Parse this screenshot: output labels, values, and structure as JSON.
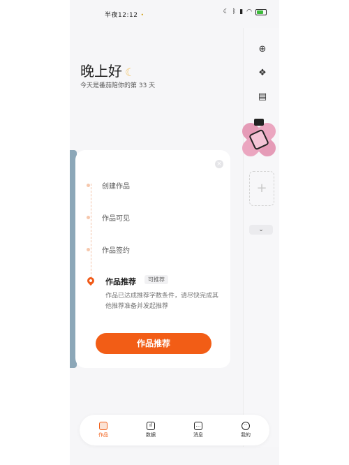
{
  "status": {
    "time": "半夜12:12",
    "indicator": "•"
  },
  "greeting": {
    "title": "晚上好",
    "moon": "☾",
    "days_text": "今天是番茄陪你的第 33 天"
  },
  "sidebar": {
    "add_icon": "plus-circle-icon",
    "grid_icon": "grid-icon",
    "calendar_icon": "calendar-icon",
    "plus": "+",
    "chevron": "⌄"
  },
  "card": {
    "close": "×",
    "steps": [
      "创建作品",
      "作品可见",
      "作品签约"
    ],
    "active": {
      "title": "作品推荐",
      "badge": "可推荐",
      "description": "作品已达成推荐字数条件，请尽快完成其他推荐准备并发起推荐"
    },
    "cta": "作品推荐"
  },
  "tabs": [
    {
      "label": "作品",
      "icon": "works-icon"
    },
    {
      "label": "数据",
      "icon": "chart-icon"
    },
    {
      "label": "消息",
      "icon": "message-icon"
    },
    {
      "label": "我的",
      "icon": "profile-icon"
    }
  ],
  "colors": {
    "accent": "#f25d16",
    "sticker": "#e59bb7"
  }
}
